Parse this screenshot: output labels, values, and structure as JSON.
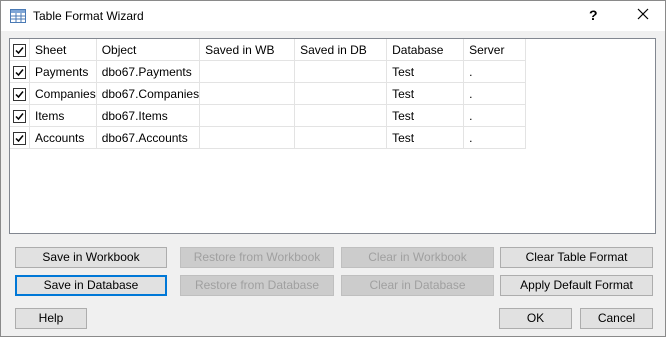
{
  "window": {
    "title": "Table Format Wizard",
    "help_glyph": "?",
    "close_glyph": "✕"
  },
  "grid": {
    "header_checked": true,
    "columns": [
      "Sheet",
      "Object",
      "Saved in WB",
      "Saved in DB",
      "Database",
      "Server"
    ],
    "rows": [
      {
        "checked": true,
        "sheet": "Payments",
        "object": "dbo67.Payments",
        "saved_wb": "",
        "saved_db": "",
        "database": "Test",
        "server": "."
      },
      {
        "checked": true,
        "sheet": "Companies",
        "object": "dbo67.Companies",
        "saved_wb": "",
        "saved_db": "",
        "database": "Test",
        "server": "."
      },
      {
        "checked": true,
        "sheet": "Items",
        "object": "dbo67.Items",
        "saved_wb": "",
        "saved_db": "",
        "database": "Test",
        "server": "."
      },
      {
        "checked": true,
        "sheet": "Accounts",
        "object": "dbo67.Accounts",
        "saved_wb": "",
        "saved_db": "",
        "database": "Test",
        "server": "."
      }
    ]
  },
  "buttons": {
    "save_in_workbook": "Save in Workbook",
    "restore_from_workbook": "Restore from Workbook",
    "clear_in_workbook": "Clear in Workbook",
    "clear_table_format": "Clear Table Format",
    "save_in_database": "Save in Database",
    "restore_from_database": "Restore from Database",
    "clear_in_database": "Clear in Database",
    "apply_default_format": "Apply Default Format",
    "help": "Help",
    "ok": "OK",
    "cancel": "Cancel"
  }
}
